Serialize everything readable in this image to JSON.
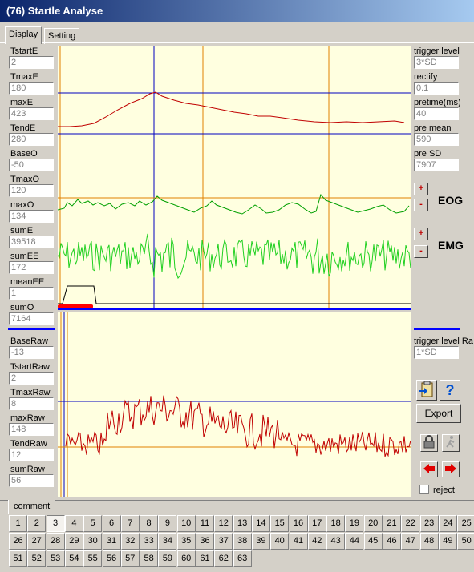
{
  "window": {
    "title": "(76) Startle Analyse"
  },
  "tabs": [
    {
      "label": "Display"
    },
    {
      "label": "Setting"
    }
  ],
  "left_fields": [
    {
      "label": "TstartE",
      "value": "2"
    },
    {
      "label": "TmaxE",
      "value": "180"
    },
    {
      "label": "maxE",
      "value": "423"
    },
    {
      "label": "TendE",
      "value": "280"
    },
    {
      "label": "BaseO",
      "value": "-50"
    },
    {
      "label": "TmaxO",
      "value": "120"
    },
    {
      "label": "maxO",
      "value": "134"
    },
    {
      "label": "sumE",
      "value": "39518"
    },
    {
      "label": "sumEE",
      "value": "172"
    },
    {
      "label": "meanEE",
      "value": "1"
    },
    {
      "label": "sumO",
      "value": "7164"
    }
  ],
  "raw_fields": [
    {
      "label": "BaseRaw",
      "value": "-13"
    },
    {
      "label": "TstartRaw",
      "value": "2"
    },
    {
      "label": "TmaxRaw",
      "value": "8"
    },
    {
      "label": "maxRaw",
      "value": "148"
    },
    {
      "label": "TendRaw",
      "value": "12"
    },
    {
      "label": "sumRaw",
      "value": "56"
    }
  ],
  "right_fields": [
    {
      "label": "trigger level",
      "value": "3*SD"
    },
    {
      "label": "rectify",
      "value": "0.1"
    },
    {
      "label": "pretime(ms)",
      "value": "40"
    },
    {
      "label": "pre mean",
      "value": "590"
    },
    {
      "label": "pre  SD",
      "value": "7907"
    }
  ],
  "raw_trigger": {
    "label": "trigger level Ra",
    "value": "1*SD"
  },
  "scale": {
    "plus": "+",
    "minus": "-"
  },
  "signals": {
    "eog": "EOG",
    "emg": "EMG"
  },
  "buttons": {
    "export": "Export",
    "help": "?",
    "reject": "reject"
  },
  "comment_tab": "comment",
  "trials": [
    "1",
    "2",
    "3",
    "4",
    "5",
    "6",
    "7",
    "8",
    "9",
    "10",
    "11",
    "12",
    "13",
    "14",
    "15",
    "16",
    "17",
    "18",
    "19",
    "20",
    "21",
    "22",
    "23",
    "24",
    "25",
    "26",
    "27",
    "28",
    "29",
    "30",
    "31",
    "32",
    "33",
    "34",
    "35",
    "36",
    "37",
    "38",
    "39",
    "40",
    "41",
    "42",
    "43",
    "44",
    "45",
    "46",
    "47",
    "48",
    "49",
    "50",
    "51",
    "52",
    "53",
    "54",
    "55",
    "56",
    "57",
    "58",
    "59",
    "60",
    "61",
    "62",
    "63"
  ],
  "active_trial": "3",
  "colors": {
    "plot_bg": "#ffffe0",
    "trace_red": "#c00000",
    "trace_green": "#00a000",
    "trace_emg": "#20d020",
    "grid_blue": "#0000c0",
    "grid_orange": "#e08000",
    "separator": "#0000ff"
  }
}
